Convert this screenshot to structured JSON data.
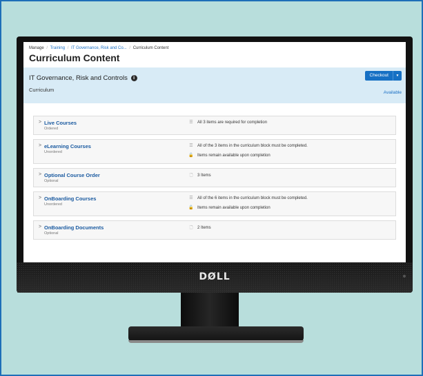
{
  "breadcrumb": {
    "manage": "Manage",
    "sep": "/",
    "training": "Training",
    "program": "IT Governance, Risk and Co...",
    "current": "Curriculum Content"
  },
  "page_title": "Curriculum Content",
  "curriculum": {
    "title": "IT Governance, Risk and Controls",
    "type": "Curriculum",
    "checkout_label": "Checkout",
    "availability": "Available"
  },
  "blocks": [
    {
      "title": "Live Courses",
      "order": "Ordered",
      "details": [
        {
          "icon": "list-icon",
          "text": "All 3 items are required for completion"
        }
      ]
    },
    {
      "title": "eLearning Courses",
      "order": "Unordered",
      "details": [
        {
          "icon": "list-icon",
          "text": "All of the 3 items in the curriculum block must be completed."
        },
        {
          "icon": "unlock-icon",
          "text": "Items remain available upon completion"
        }
      ]
    },
    {
      "title": "Optional Course Order",
      "order": "Optional",
      "details": [
        {
          "icon": "document-icon",
          "text": "3 Items"
        }
      ]
    },
    {
      "title": "OnBoarding Courses",
      "order": "Unordered",
      "details": [
        {
          "icon": "list-icon",
          "text": "All of the 6 items in the curriculum block must be completed."
        },
        {
          "icon": "unlock-icon",
          "text": "Items remain available upon completion"
        }
      ]
    },
    {
      "title": "OnBoarding Documents",
      "order": "Optional",
      "details": [
        {
          "icon": "document-icon",
          "text": "2 Items"
        }
      ]
    }
  ],
  "monitor": {
    "brand": "DØLL"
  },
  "colors": {
    "accent": "#1670c4",
    "background": "#b8dedc",
    "panel": "#d8ebf6"
  }
}
